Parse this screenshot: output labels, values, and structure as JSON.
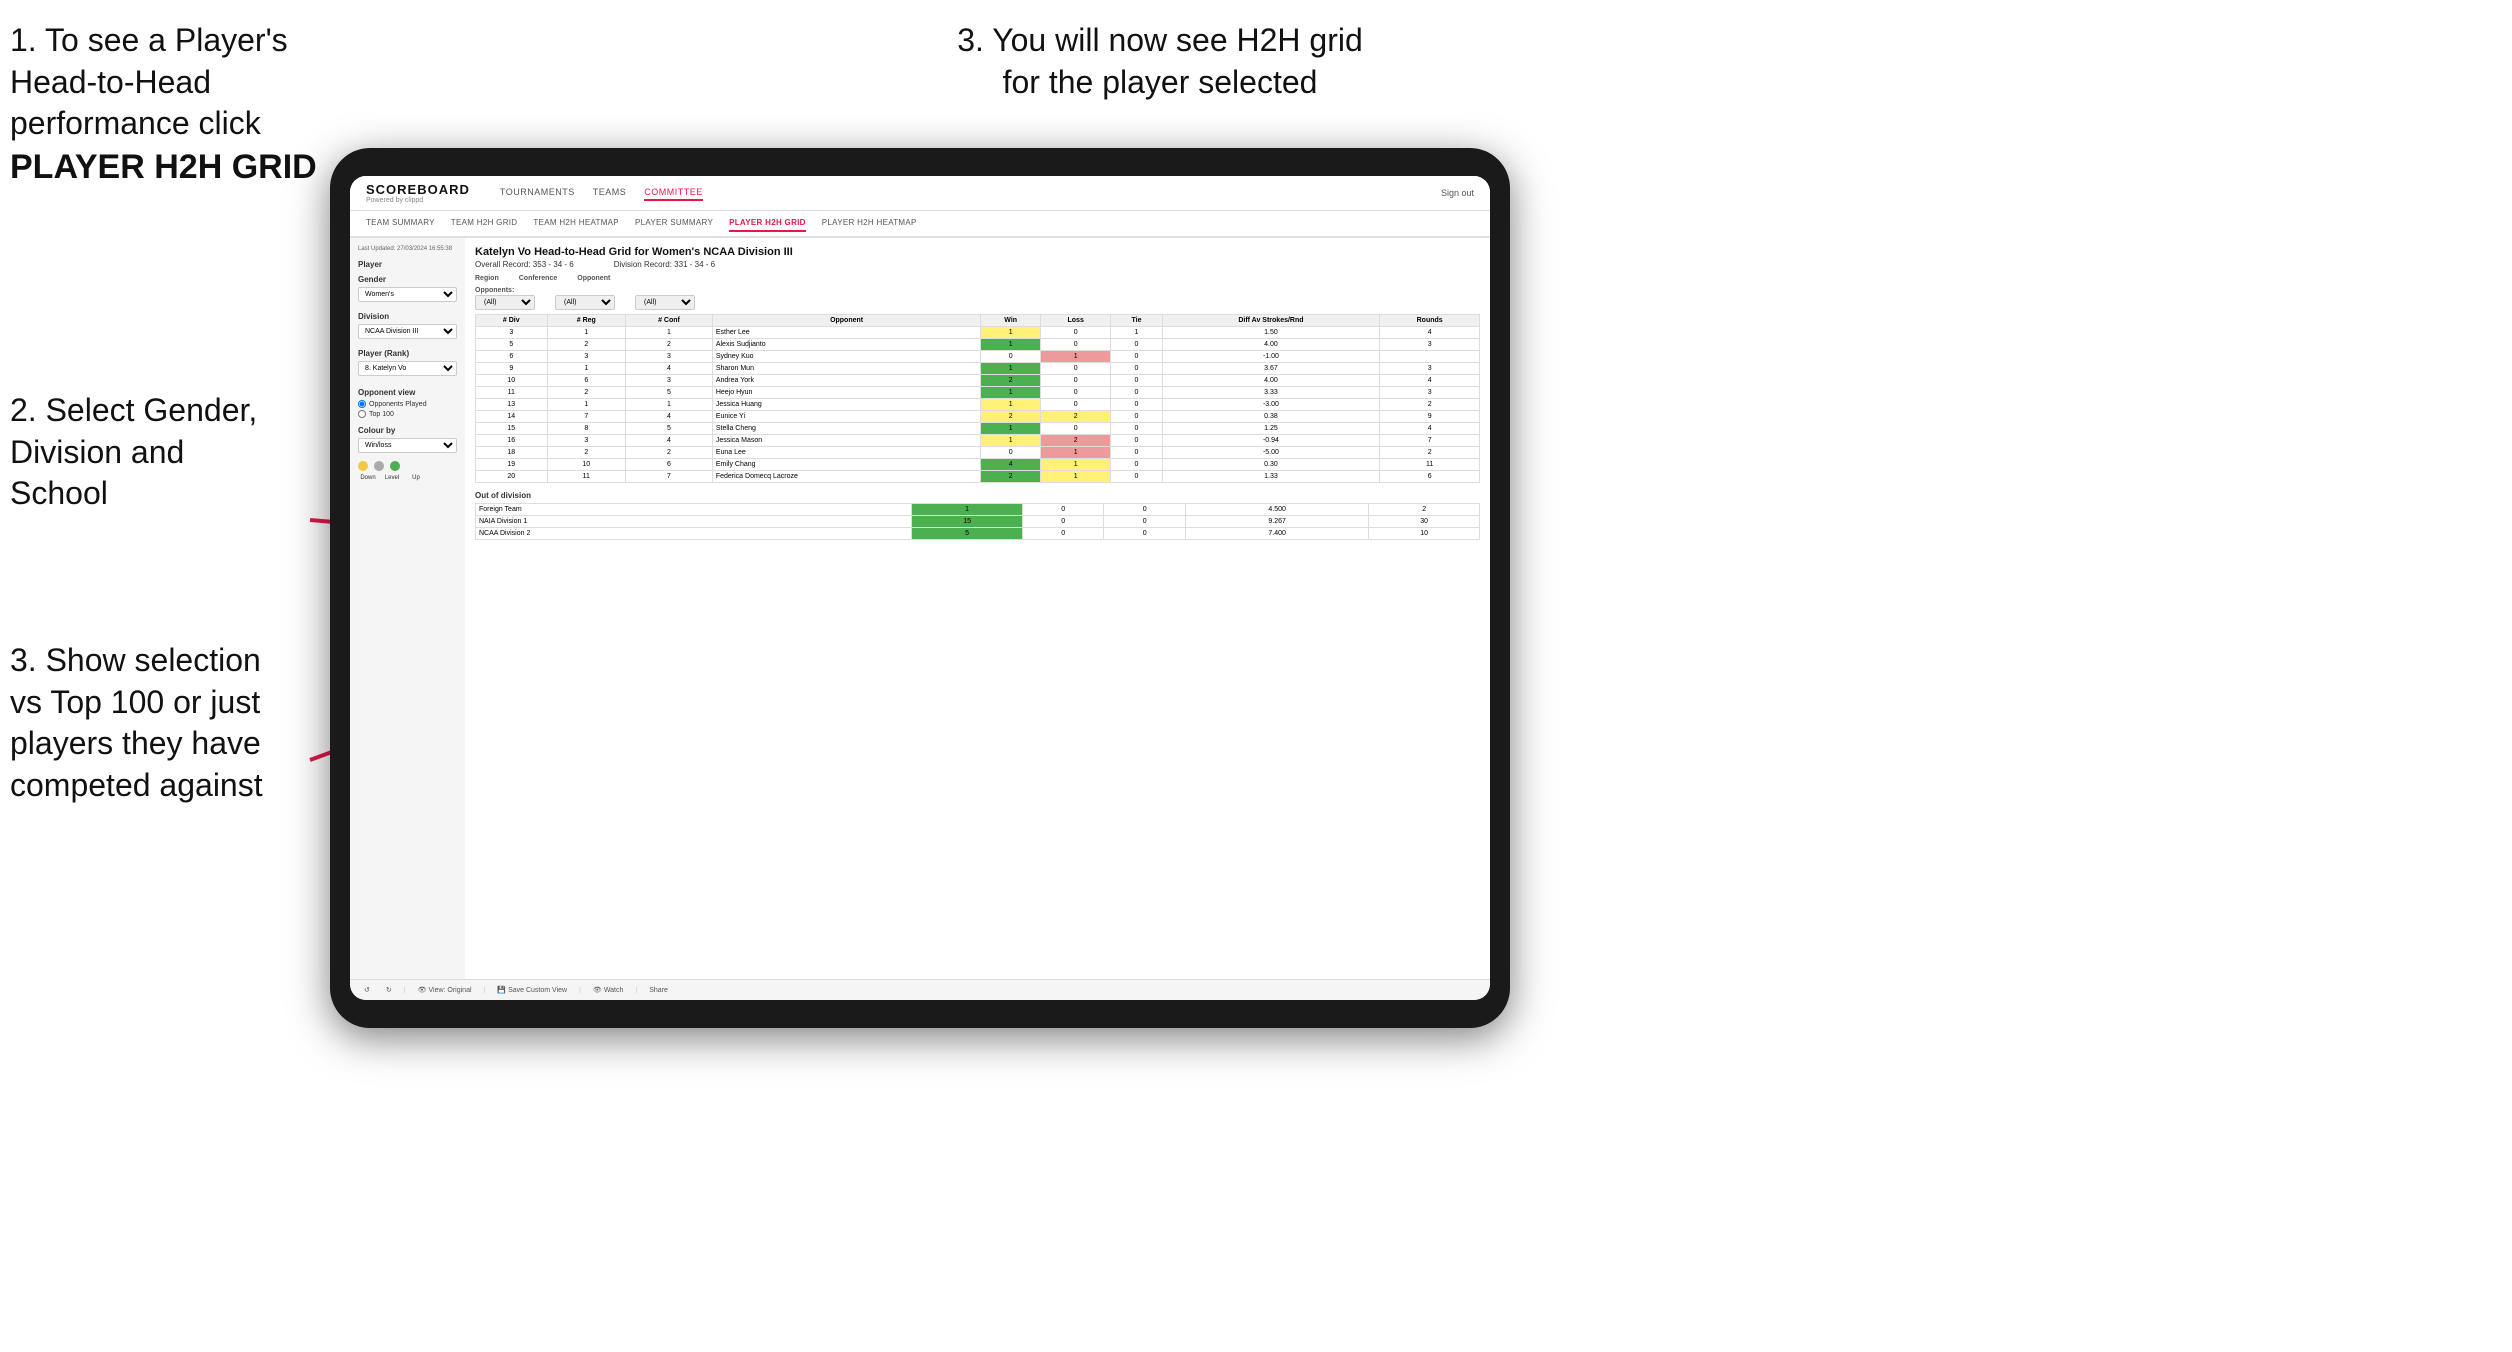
{
  "instructions": {
    "top_left_1": "1. To see a Player's Head-to-Head performance click",
    "top_left_bold": "PLAYER H2H GRID",
    "top_right": "3. You will now see H2H grid for the player selected",
    "mid_left": "2. Select Gender, Division and School",
    "bottom_left": "3. Show selection vs Top 100 or just players they have competed against"
  },
  "nav": {
    "logo": "SCOREBOARD",
    "powered_by": "Powered by clippd",
    "items": [
      "TOURNAMENTS",
      "TEAMS",
      "COMMITTEE"
    ],
    "active_item": "COMMITTEE",
    "right": "Sign out"
  },
  "sub_nav": {
    "items": [
      "TEAM SUMMARY",
      "TEAM H2H GRID",
      "TEAM H2H HEATMAP",
      "PLAYER SUMMARY",
      "PLAYER H2H GRID",
      "PLAYER H2H HEATMAP"
    ],
    "active": "PLAYER H2H GRID"
  },
  "left_panel": {
    "timestamp": "Last Updated: 27/03/2024 16:55:38",
    "player_label": "Player",
    "gender_label": "Gender",
    "gender_value": "Women's",
    "division_label": "Division",
    "division_value": "NCAA Division III",
    "player_rank_label": "Player (Rank)",
    "player_rank_value": "8. Katelyn Vo",
    "opponent_view_label": "Opponent view",
    "opponent_options": [
      "Opponents Played",
      "Top 100"
    ],
    "opponent_selected": "Opponents Played",
    "colour_by_label": "Colour by",
    "colour_by_value": "Win/loss",
    "legend": {
      "labels": [
        "Down",
        "Level",
        "Up"
      ],
      "colors": [
        "yellow",
        "gray",
        "green"
      ]
    }
  },
  "main": {
    "title": "Katelyn Vo Head-to-Head Grid for Women's NCAA Division III",
    "overall_record": "Overall Record: 353 - 34 - 6",
    "division_record": "Division Record: 331 - 34 - 6",
    "filters": {
      "opponents_label": "Opponents:",
      "opponents_value": "(All)",
      "conference_label": "Conference",
      "conference_value": "(All)",
      "opponent_label": "Opponent",
      "opponent_value": "(All)"
    },
    "table_headers": [
      "# Div",
      "# Reg",
      "# Conf",
      "Opponent",
      "Win",
      "Loss",
      "Tie",
      "Diff Av Strokes/Rnd",
      "Rounds"
    ],
    "rows": [
      {
        "div": "3",
        "reg": "1",
        "conf": "1",
        "opponent": "Esther Lee",
        "win": "1",
        "loss": "0",
        "tie": "1",
        "diff": "1.50",
        "rounds": "4",
        "win_color": "yellow",
        "loss_color": "white",
        "tie_color": "white"
      },
      {
        "div": "5",
        "reg": "2",
        "conf": "2",
        "opponent": "Alexis Sudjianto",
        "win": "1",
        "loss": "0",
        "tie": "0",
        "diff": "4.00",
        "rounds": "3",
        "win_color": "green",
        "loss_color": "white",
        "tie_color": "white"
      },
      {
        "div": "6",
        "reg": "3",
        "conf": "3",
        "opponent": "Sydney Kuo",
        "win": "0",
        "loss": "1",
        "tie": "0",
        "diff": "-1.00",
        "rounds": "",
        "win_color": "white",
        "loss_color": "red",
        "tie_color": "white"
      },
      {
        "div": "9",
        "reg": "1",
        "conf": "4",
        "opponent": "Sharon Mun",
        "win": "1",
        "loss": "0",
        "tie": "0",
        "diff": "3.67",
        "rounds": "3",
        "win_color": "green",
        "loss_color": "white",
        "tie_color": "white"
      },
      {
        "div": "10",
        "reg": "6",
        "conf": "3",
        "opponent": "Andrea York",
        "win": "2",
        "loss": "0",
        "tie": "0",
        "diff": "4.00",
        "rounds": "4",
        "win_color": "green",
        "loss_color": "white",
        "tie_color": "white"
      },
      {
        "div": "11",
        "reg": "2",
        "conf": "5",
        "opponent": "Heejo Hyun",
        "win": "1",
        "loss": "0",
        "tie": "0",
        "diff": "3.33",
        "rounds": "3",
        "win_color": "green",
        "loss_color": "white",
        "tie_color": "white"
      },
      {
        "div": "13",
        "reg": "1",
        "conf": "1",
        "opponent": "Jessica Huang",
        "win": "1",
        "loss": "0",
        "tie": "0",
        "diff": "-3.00",
        "rounds": "2",
        "win_color": "yellow",
        "loss_color": "white",
        "tie_color": "white"
      },
      {
        "div": "14",
        "reg": "7",
        "conf": "4",
        "opponent": "Eunice Yi",
        "win": "2",
        "loss": "2",
        "tie": "0",
        "diff": "0.38",
        "rounds": "9",
        "win_color": "yellow",
        "loss_color": "yellow",
        "tie_color": "white"
      },
      {
        "div": "15",
        "reg": "8",
        "conf": "5",
        "opponent": "Stella Cheng",
        "win": "1",
        "loss": "0",
        "tie": "0",
        "diff": "1.25",
        "rounds": "4",
        "win_color": "green",
        "loss_color": "white",
        "tie_color": "white"
      },
      {
        "div": "16",
        "reg": "3",
        "conf": "4",
        "opponent": "Jessica Mason",
        "win": "1",
        "loss": "2",
        "tie": "0",
        "diff": "-0.94",
        "rounds": "7",
        "win_color": "yellow",
        "loss_color": "red",
        "tie_color": "white"
      },
      {
        "div": "18",
        "reg": "2",
        "conf": "2",
        "opponent": "Euna Lee",
        "win": "0",
        "loss": "1",
        "tie": "0",
        "diff": "-5.00",
        "rounds": "2",
        "win_color": "white",
        "loss_color": "red",
        "tie_color": "white"
      },
      {
        "div": "19",
        "reg": "10",
        "conf": "6",
        "opponent": "Emily Chang",
        "win": "4",
        "loss": "1",
        "tie": "0",
        "diff": "0.30",
        "rounds": "11",
        "win_color": "green",
        "loss_color": "yellow",
        "tie_color": "white"
      },
      {
        "div": "20",
        "reg": "11",
        "conf": "7",
        "opponent": "Federica Domecq Lacroze",
        "win": "2",
        "loss": "1",
        "tie": "0",
        "diff": "1.33",
        "rounds": "6",
        "win_color": "green",
        "loss_color": "yellow",
        "tie_color": "white"
      }
    ],
    "out_of_division_label": "Out of division",
    "out_of_division_rows": [
      {
        "team": "Foreign Team",
        "win": "1",
        "loss": "0",
        "tie": "0",
        "diff": "4.500",
        "rounds": "2"
      },
      {
        "team": "NAIA Division 1",
        "win": "15",
        "loss": "0",
        "tie": "0",
        "diff": "9.267",
        "rounds": "30"
      },
      {
        "team": "NCAA Division 2",
        "win": "5",
        "loss": "0",
        "tie": "0",
        "diff": "7.400",
        "rounds": "10"
      }
    ]
  },
  "toolbar": {
    "view_original": "View: Original",
    "save_custom": "Save Custom View",
    "watch": "Watch",
    "share": "Share"
  }
}
